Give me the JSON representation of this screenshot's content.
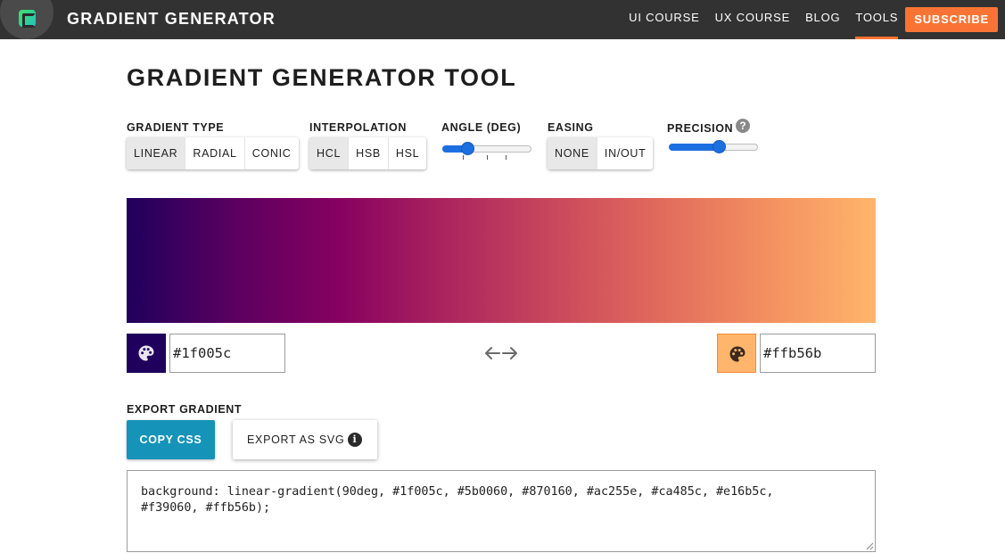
{
  "brand": {
    "name": "GRADIENT GENERATOR"
  },
  "nav": {
    "items": [
      "UI COURSE",
      "UX COURSE",
      "BLOG",
      "TOOLS"
    ],
    "active": "TOOLS",
    "subscribe": "SUBSCRIBE"
  },
  "page": {
    "title": "GRADIENT GENERATOR TOOL"
  },
  "controls": {
    "gradient_type": {
      "label": "GRADIENT TYPE",
      "options": [
        "LINEAR",
        "RADIAL",
        "CONIC"
      ],
      "selected": "LINEAR"
    },
    "interpolation": {
      "label": "INTERPOLATION",
      "options": [
        "HCL",
        "HSB",
        "HSL"
      ],
      "selected": "HCL"
    },
    "angle": {
      "label": "ANGLE (DEG)",
      "value_fraction": 0.25
    },
    "easing": {
      "label": "EASING",
      "options": [
        "NONE",
        "IN/OUT"
      ],
      "selected": "NONE"
    },
    "precision": {
      "label": "PRECISION",
      "value_fraction": 0.58
    }
  },
  "colors": {
    "start": "#1f005c",
    "end": "#ffb56b",
    "stops": [
      "#1f005c",
      "#5b0060",
      "#870160",
      "#ac255e",
      "#ca485c",
      "#e16b5c",
      "#f39060",
      "#ffb56b"
    ],
    "accent": "#f97434",
    "copy_button": "#1593b8",
    "slider": "#1c6fe0"
  },
  "icons": {
    "start_picker": "palette-icon",
    "end_picker": "palette-icon",
    "swap": "swap-arrows-icon",
    "help": "question-icon",
    "info": "info-icon"
  },
  "export": {
    "label": "EXPORT GRADIENT",
    "copy_css": "COPY CSS",
    "export_svg": "EXPORT AS SVG",
    "css_code": "background: linear-gradient(90deg, #1f005c, #5b0060, #870160, #ac255e, #ca485c, #e16b5c,\n#f39060, #ffb56b);"
  }
}
